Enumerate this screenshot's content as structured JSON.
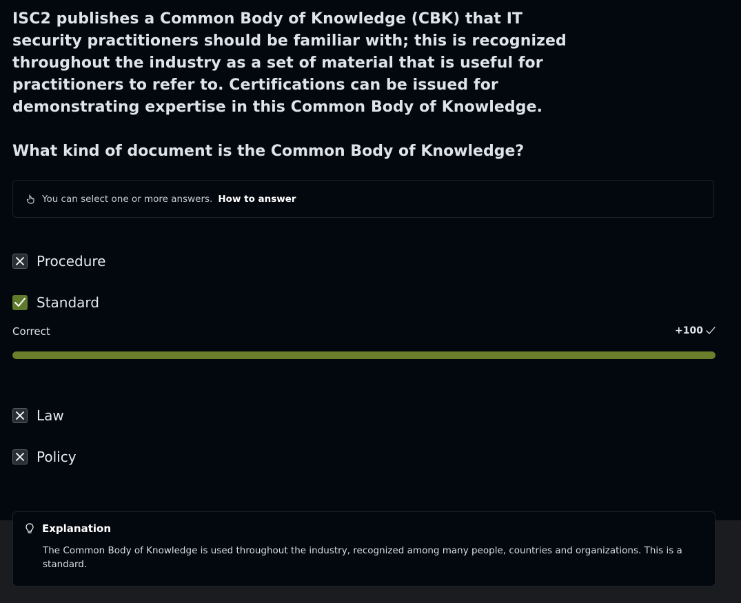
{
  "question": {
    "text": "ISC2 publishes a Common Body of Knowledge (CBK) that IT security practitioners should be familiar with; this is recognized throughout the industry as a set of material that is useful for practitioners to refer to. Certifications can be issued for demonstrating expertise in this Common Body of Knowledge.",
    "prompt": "What kind of document is the Common Body of Knowledge?"
  },
  "hint": {
    "icon": "hand-pointer-icon",
    "text": "You can select one or more answers.",
    "link": "How to answer"
  },
  "options": [
    {
      "label": "Procedure",
      "state": "incorrect"
    },
    {
      "label": "Standard",
      "state": "correct"
    },
    {
      "label": "Law",
      "state": "incorrect"
    },
    {
      "label": "Policy",
      "state": "incorrect"
    }
  ],
  "result": {
    "label": "Correct",
    "score": "+100",
    "progress_percent": 100,
    "color": "#6b7f2a"
  },
  "explanation": {
    "icon": "lightbulb-icon",
    "title": "Explanation",
    "text": "The Common Body of Knowledge is used throughout the industry, recognized among many people, countries and organizations. This is a standard."
  }
}
